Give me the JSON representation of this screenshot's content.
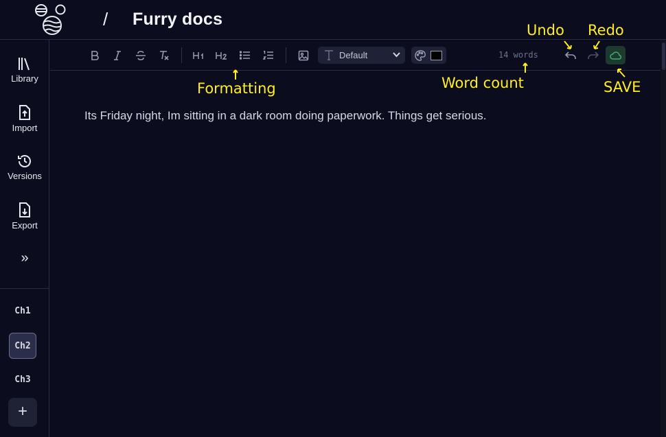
{
  "header": {
    "separator": "/",
    "doc_title": "Furry docs"
  },
  "sidebar": {
    "items": [
      {
        "label": "Library",
        "icon": "library-icon"
      },
      {
        "label": "Import",
        "icon": "import-icon"
      },
      {
        "label": "Versions",
        "icon": "history-icon"
      },
      {
        "label": "Export",
        "icon": "export-icon"
      }
    ],
    "expand_label": "»",
    "chapters": [
      "Ch1",
      "Ch2",
      "Ch3"
    ],
    "active_chapter": "Ch2",
    "add_label": "+"
  },
  "toolbar": {
    "font_family_value": "Default",
    "text_color": "#000000",
    "word_count": "14 words",
    "save_accent": "#2f8a5c"
  },
  "editor": {
    "text": "Its Friday night, Im sitting in a dark room doing paperwork. Things get serious."
  },
  "annotations": {
    "undo": "Undo",
    "redo": "Redo",
    "formatting": "Formatting",
    "word_count": "Word count",
    "save": "SAVE",
    "color": "#ffee22"
  }
}
